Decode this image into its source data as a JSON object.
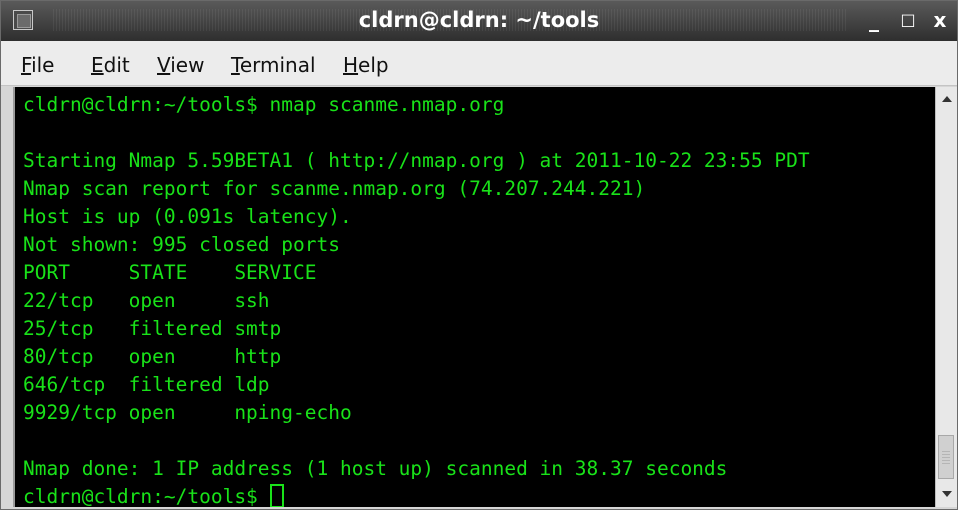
{
  "window": {
    "title": "cldrn@cldrn: ~/tools",
    "icon": "terminal-icon",
    "controls": {
      "minimize": "_",
      "maximize": "□",
      "close": "x"
    }
  },
  "menu": [
    {
      "key": "F",
      "rest": "ile"
    },
    {
      "key": "E",
      "rest": "dit"
    },
    {
      "key": "V",
      "rest": "iew"
    },
    {
      "key": "T",
      "rest": "erminal"
    },
    {
      "key": "H",
      "rest": "elp"
    }
  ],
  "terminal": {
    "text_color": "#19e219",
    "background": "#000000",
    "lines": [
      "cldrn@cldrn:~/tools$ nmap scanme.nmap.org",
      "",
      "Starting Nmap 5.59BETA1 ( http://nmap.org ) at 2011-10-22 23:55 PDT",
      "Nmap scan report for scanme.nmap.org (74.207.244.221)",
      "Host is up (0.091s latency).",
      "Not shown: 995 closed ports",
      "PORT     STATE    SERVICE",
      "22/tcp   open     ssh",
      "25/tcp   filtered smtp",
      "80/tcp   open     http",
      "646/tcp  filtered ldp",
      "9929/tcp open     nping-echo",
      "",
      "Nmap done: 1 IP address (1 host up) scanned in 38.37 seconds"
    ],
    "prompt": "cldrn@cldrn:~/tools$ "
  }
}
